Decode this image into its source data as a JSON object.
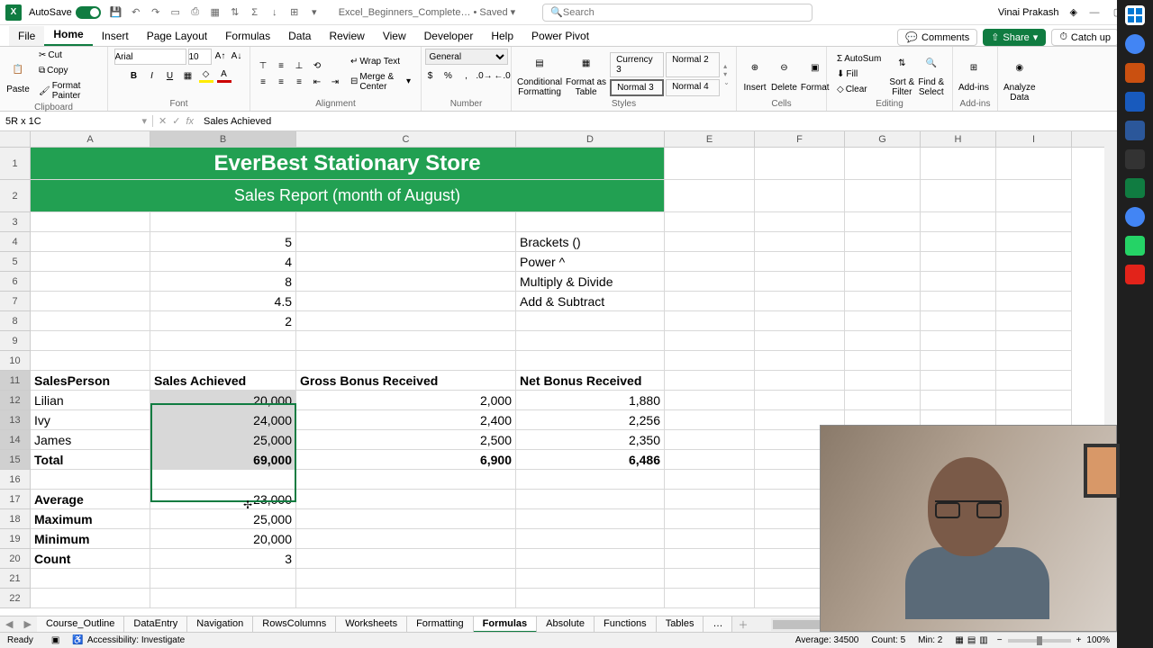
{
  "titlebar": {
    "autosave": "AutoSave",
    "filename": "Excel_Beginners_Complete… • Saved ▾",
    "search_placeholder": "Search",
    "user": "Vinai Prakash"
  },
  "tabs": [
    "File",
    "Home",
    "Insert",
    "Page Layout",
    "Formulas",
    "Data",
    "Review",
    "View",
    "Developer",
    "Help",
    "Power Pivot"
  ],
  "active_tab": "Home",
  "ribbon_actions": {
    "comments": "Comments",
    "share": "Share",
    "catchup": "Catch up"
  },
  "ribbon": {
    "clipboard": {
      "label": "Clipboard",
      "paste": "Paste",
      "cut": "Cut",
      "copy": "Copy",
      "fmtpainter": "Format Painter"
    },
    "font": {
      "label": "Font",
      "name": "Arial",
      "size": "10"
    },
    "alignment": {
      "label": "Alignment",
      "wrap": "Wrap Text",
      "merge": "Merge & Center"
    },
    "number": {
      "label": "Number",
      "format": "General"
    },
    "styles": {
      "label": "Styles",
      "cf": "Conditional\nFormatting",
      "ft": "Format as\nTable",
      "c3": "Currency 3",
      "n2": "Normal 2",
      "n3": "Normal 3",
      "n4": "Normal 4"
    },
    "cells": {
      "label": "Cells",
      "ins": "Insert",
      "del": "Delete",
      "fmt": "Format"
    },
    "editing": {
      "label": "Editing",
      "sum": "AutoSum",
      "fill": "Fill",
      "clear": "Clear",
      "sort": "Sort &\nFilter",
      "find": "Find &\nSelect"
    },
    "addins": {
      "label": "Add-ins",
      "btn": "Add-ins"
    },
    "analyze": {
      "btn": "Analyze\nData"
    }
  },
  "namebox": "5R x 1C",
  "formula": "Sales Achieved",
  "columns": [
    "A",
    "B",
    "C",
    "D",
    "E",
    "F",
    "G",
    "H",
    "I"
  ],
  "title_row": "EverBest Stationary Store",
  "subtitle_row": "Sales Report (month of August)",
  "misc": {
    "b4": "5",
    "b5": "4",
    "b6": "8",
    "b7": "4.5",
    "b8": "2",
    "d4": "Brackets ()",
    "d5": "Power ^",
    "d6": "Multiply & Divide",
    "d7": "Add & Subtract"
  },
  "headers": {
    "a": "SalesPerson",
    "b": "Sales Achieved",
    "c": "Gross Bonus Received",
    "d": "Net Bonus Received"
  },
  "data_rows": [
    {
      "a": "Lilian",
      "b": "20,000",
      "c": "2,000",
      "d": "1,880"
    },
    {
      "a": "Ivy",
      "b": "24,000",
      "c": "2,400",
      "d": "2,256"
    },
    {
      "a": "James",
      "b": "25,000",
      "c": "2,500",
      "d": "2,350"
    }
  ],
  "total": {
    "a": "Total",
    "b": "69,000",
    "c": "6,900",
    "d": "6,486"
  },
  "stats": [
    {
      "a": "Average",
      "b": "23,000"
    },
    {
      "a": "Maximum",
      "b": "25,000"
    },
    {
      "a": "Minimum",
      "b": "20,000"
    },
    {
      "a": "Count",
      "b": "3"
    }
  ],
  "sheets": [
    "Course_Outline",
    "DataEntry",
    "Navigation",
    "RowsColumns",
    "Worksheets",
    "Formatting",
    "Formulas",
    "Absolute",
    "Functions",
    "Tables",
    "…"
  ],
  "active_sheet": "Formulas",
  "status": {
    "ready": "Ready",
    "acc": "Accessibility: Investigate",
    "avg": "Average: 34500",
    "cnt": "Count: 5",
    "min": "Min: 2",
    "zoom": "100%"
  }
}
